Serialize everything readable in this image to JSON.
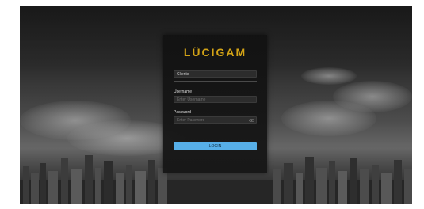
{
  "brand": {
    "logo_text": "LÜCIGAM",
    "logo_color": "#d3a316"
  },
  "login": {
    "server_select": {
      "value": "Cliente"
    },
    "username": {
      "label": "Username",
      "placeholder": "Enter Username"
    },
    "password": {
      "label": "Password",
      "placeholder": "Enter Password"
    },
    "submit_label": "LOGIN",
    "submit_color": "#57afe8"
  },
  "icons": {
    "select_chevron": "chevron-down-icon",
    "password_toggle": "eye-icon"
  }
}
